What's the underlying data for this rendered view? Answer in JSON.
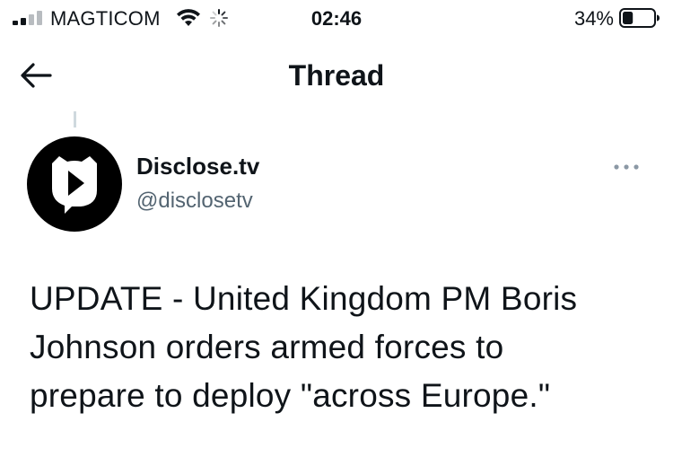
{
  "status_bar": {
    "carrier": "MAGTICOM",
    "time": "02:46",
    "battery_percent": "34%",
    "battery_level": 0.34,
    "signal_bars_active": 2,
    "signal_bars_total": 4,
    "icons": [
      "signal-icon",
      "wifi-icon",
      "loading-spinner-icon",
      "battery-icon"
    ]
  },
  "nav": {
    "title": "Thread",
    "back_icon": "arrow-left-icon"
  },
  "tweet": {
    "author_name": "Disclose.tv",
    "author_handle": "@disclosetv",
    "avatar_icon": "play-cat-logo-icon",
    "more_icon": "more-dots-icon",
    "text": "UPDATE - United Kingdom PM Boris\nJohnson orders armed forces to\nprepare to deploy \"across Europe.\""
  },
  "colors": {
    "text_primary": "#0f1419",
    "text_secondary": "#536471",
    "thread_line": "#cfd9de",
    "avatar_bg": "#000000"
  }
}
